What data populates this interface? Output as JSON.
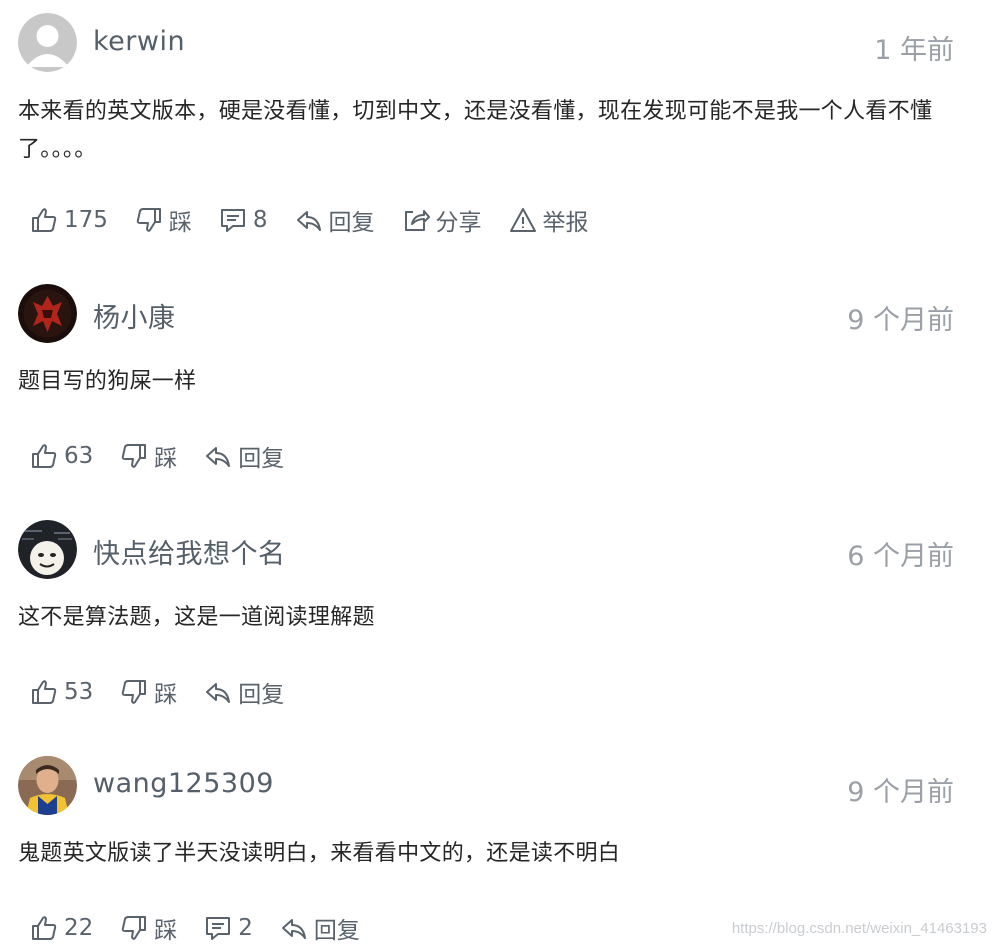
{
  "comments": [
    {
      "username": "kerwin",
      "time": "1 年前",
      "avatar": "default-user-icon",
      "content": "本来看的英文版本，硬是没看懂，切到中文，还是没看懂，现在发现可能不是我一个人看不懂了。。。。",
      "likes": "175",
      "dislike_label": "踩",
      "replies": "8",
      "reply_label": "回复",
      "share_label": "分享",
      "report_label": "举报"
    },
    {
      "username": "杨小康",
      "time": "9 个月前",
      "avatar": "horde-emblem-icon",
      "content": "题目写的狗屎一样",
      "likes": "63",
      "dislike_label": "踩",
      "reply_label": "回复"
    },
    {
      "username": "快点给我想个名",
      "time": "6 个月前",
      "avatar": "meme-face-icon",
      "content": "这不是算法题，这是一道阅读理解题",
      "likes": "53",
      "dislike_label": "踩",
      "reply_label": "回复"
    },
    {
      "username": "wang125309",
      "time": "9 个月前",
      "avatar": "basketball-player-photo",
      "content": "鬼题英文版读了半天没读明白，来看看中文的，还是读不明白",
      "likes": "22",
      "dislike_label": "踩",
      "replies": "2",
      "reply_label": "回复"
    }
  ],
  "watermark": "https://blog.csdn.net/weixin_41463193",
  "colors": {
    "text": "#262626",
    "username": "#555f6a",
    "muted": "#9aa0a6",
    "action": "#5a636c"
  }
}
